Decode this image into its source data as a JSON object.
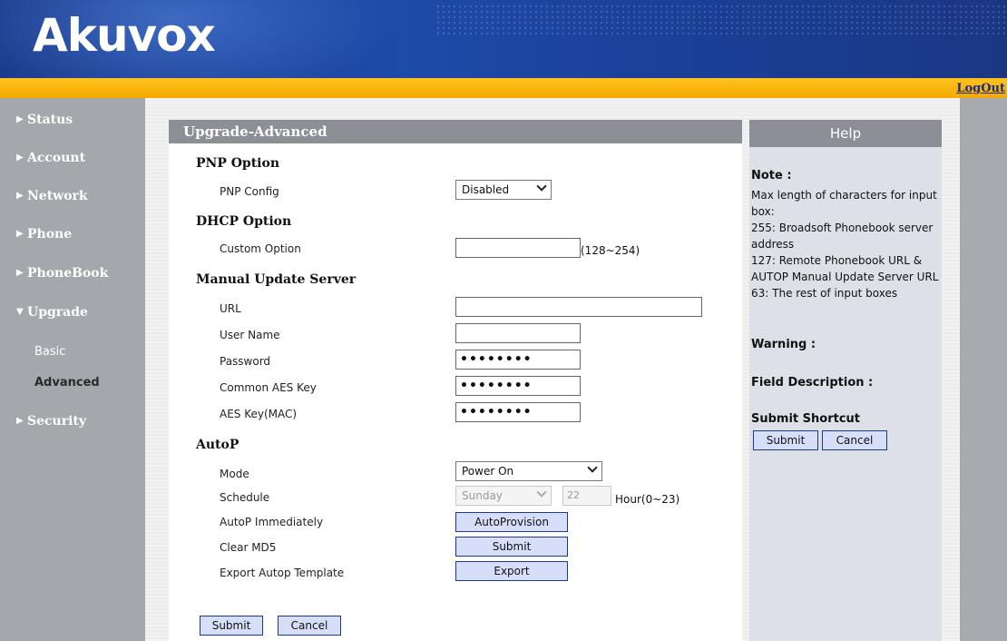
{
  "header": {
    "logo": "Akuvox",
    "logout": "LogOut"
  },
  "sidebar": {
    "items": [
      {
        "label": "Status"
      },
      {
        "label": "Account"
      },
      {
        "label": "Network"
      },
      {
        "label": "Phone"
      },
      {
        "label": "PhoneBook"
      },
      {
        "label": "Upgrade"
      },
      {
        "label": "Security"
      }
    ],
    "sub": [
      {
        "label": "Basic"
      },
      {
        "label": "Advanced"
      }
    ]
  },
  "panel": {
    "title": "Upgrade-Advanced",
    "pnp": {
      "heading": "PNP Option",
      "config_label": "PNP Config",
      "config_value": "Disabled"
    },
    "dhcp": {
      "heading": "DHCP Option",
      "custom_label": "Custom Option",
      "custom_value": "",
      "custom_hint": "(128~254)"
    },
    "manual": {
      "heading": "Manual Update Server",
      "url_label": "URL",
      "url_value": "",
      "username_label": "User Name",
      "username_value": "",
      "password_label": "Password",
      "password_value": "••••••••",
      "common_aes_label": "Common AES Key",
      "common_aes_value": "••••••••",
      "aes_mac_label": "AES Key(MAC)",
      "aes_mac_value": "••••••••"
    },
    "autop": {
      "heading": "AutoP",
      "mode_label": "Mode",
      "mode_value": "Power On",
      "schedule_label": "Schedule",
      "schedule_day": "Sunday",
      "schedule_hour": "22",
      "schedule_hint": "Hour(0~23)",
      "immediate_label": "AutoP Immediately",
      "immediate_button": "AutoProvision",
      "clear_label": "Clear MD5",
      "clear_button": "Submit",
      "export_label": "Export Autop Template",
      "export_button": "Export"
    },
    "submit": "Submit",
    "cancel": "Cancel"
  },
  "help": {
    "title": "Help",
    "note_heading": "Note :",
    "note_lines": [
      "Max length of characters for input box:",
      "255: Broadsoft Phonebook server address",
      "127: Remote Phonebook URL & AUTOP Manual Update Server URL",
      "63: The rest of input boxes"
    ],
    "warning_heading": "Warning :",
    "field_heading": "Field Description :",
    "shortcut_heading": "Submit Shortcut",
    "submit": "Submit",
    "cancel": "Cancel"
  }
}
